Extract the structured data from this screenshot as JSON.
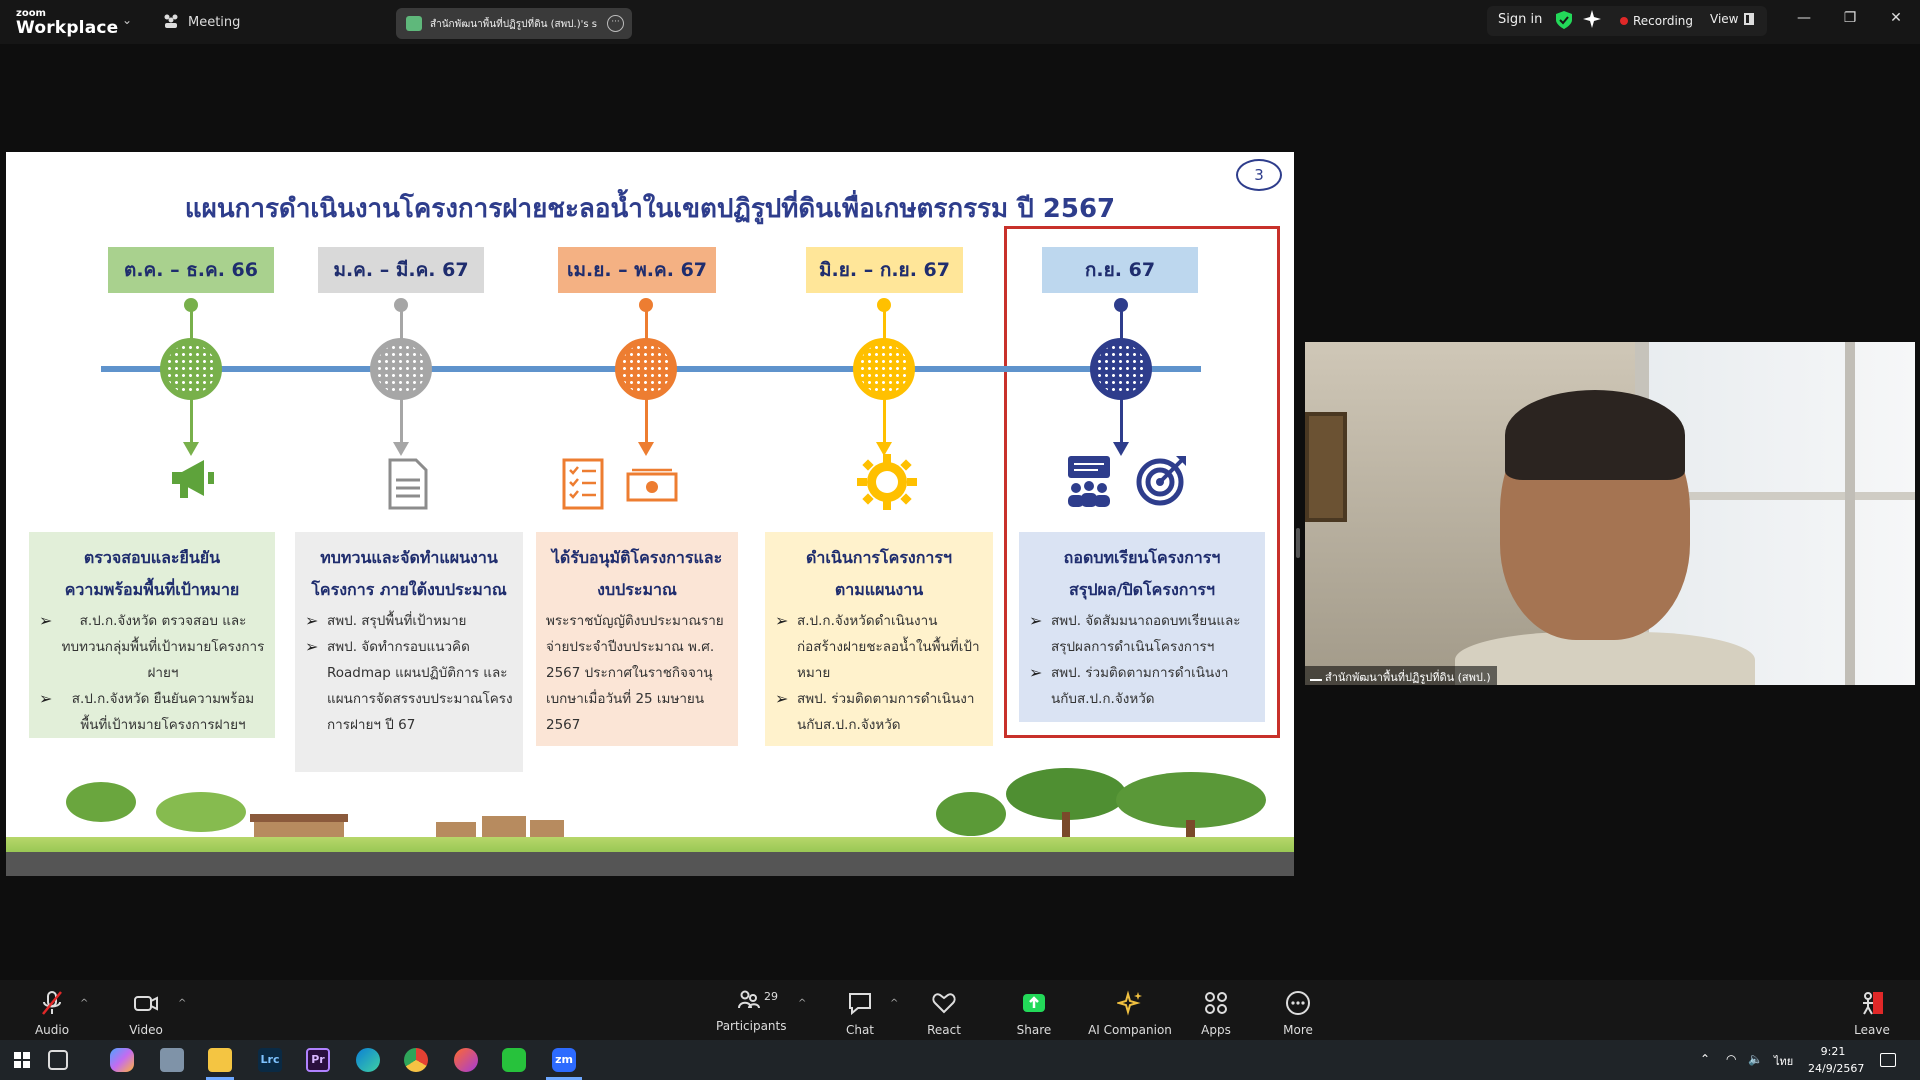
{
  "app": {
    "logo_small": "zoom",
    "logo_big": "Workplace",
    "meeting_label": "Meeting"
  },
  "share_tab": {
    "label": "สำนักพัฒนาพื้นที่ปฏิรูปที่ดิน (สพป.)'s s"
  },
  "top_right": {
    "signin": "Sign in",
    "recording": "Recording",
    "view": "View"
  },
  "slide": {
    "title": "แผนการดำเนินงานโครงการฝายชะลอน้ำในเขตปฏิรูปที่ดินเพื่อเกษตรกรรม ปี 2567",
    "page_number": "3",
    "phases": [
      {
        "label": "ต.ค. – ธ.ค. 66",
        "color": "#78b04b",
        "label_bg": "#a9d18e",
        "heading1": "ตรวจสอบและยืนยัน",
        "heading2": "ความพร้อมพื้นที่เป้าหมาย",
        "bullets": [
          {
            "text": "ส.ป.ก.จังหวัด ตรวจสอบ และทบทวนกลุ่มพื้นที่เป้าหมายโครงการฝายฯ"
          },
          {
            "text": "ส.ป.ก.จังหวัด ยืนยันความพร้อมพื้นที่เป้าหมายโครงการฝายฯ"
          }
        ],
        "card_bg": "#e2efd9",
        "icon": "megaphone-icon"
      },
      {
        "label": "ม.ค. – มี.ค. 67",
        "color": "#a6a6a6",
        "label_bg": "#d9d9d9",
        "heading1": "ทบทวนและจัดทำแผนงาน",
        "heading2": "โครงการ ภายใต้งบประมาณ",
        "bullets": [
          {
            "text": "สพป. สรุปพื้นที่เป้าหมาย"
          },
          {
            "text": "สพป. จัดทำกรอบแนวคิด Roadmap แผนปฏิบัติการ และแผนการจัดสรรงบประมาณโครงการฝายฯ ปี 67"
          }
        ],
        "card_bg": "#ededed",
        "icon": "document-icon"
      },
      {
        "label": "เม.ย. – พ.ค. 67",
        "color": "#ed7d31",
        "label_bg": "#f4b183",
        "heading1": "ได้รับอนุมัติโครงการและ",
        "heading2": "งบประมาณ",
        "body": "พระราชบัญญัติงบประมาณรายจ่ายประจำปีงบประมาณ พ.ศ. 2567 ประกาศในราชกิจจานุเบกษาเมื่อวันที่ 25 เมษายน 2567",
        "card_bg": "#fbe5d6",
        "icon": "checklist-icon"
      },
      {
        "label": "มิ.ย. – ก.ย. 67",
        "color": "#ffc000",
        "label_bg": "#ffe699",
        "heading1": "ดำเนินการโครงการฯ",
        "heading2": "ตามแผนงาน",
        "bullets": [
          {
            "text": "ส.ป.ก.จังหวัดดำเนินงานก่อสร้างฝายชะลอน้ำในพื้นที่เป้าหมาย"
          },
          {
            "text": "สพป. ร่วมติดตามการดำเนินงานกับส.ป.ก.จังหวัด"
          }
        ],
        "card_bg": "#fff2cc",
        "icon": "gear-icon"
      },
      {
        "label": "ก.ย. 67",
        "color": "#2e3d8c",
        "label_bg": "#bdd7ee",
        "heading1": "ถอดบทเรียนโครงการฯ",
        "heading2": "สรุปผล/ปิดโครงการฯ",
        "bullets": [
          {
            "text": "สพป. จัดสัมมนาถอดบทเรียนและสรุปผลการดำเนินโครงการฯ"
          },
          {
            "text": "สพป. ร่วมติดตามการดำเนินงานกับส.ป.ก.จังหวัด"
          }
        ],
        "card_bg": "#dae3f3",
        "icon": "meeting-target-icon"
      }
    ]
  },
  "webcam": {
    "name": "สำนักพัฒนาพื้นที่ปฏิรูปที่ดิน (สพป.)"
  },
  "toolbar": {
    "audio": "Audio",
    "video": "Video",
    "participants": "Participants",
    "participants_count": "29",
    "chat": "Chat",
    "react": "React",
    "share": "Share",
    "ai_companion": "AI Companion",
    "apps": "Apps",
    "more": "More",
    "leave": "Leave"
  },
  "taskbar": {
    "time": "9:21",
    "date": "24/9/2567",
    "lang": "ไทย"
  },
  "colors": {
    "accent_green": "#23d959",
    "record_red": "#e02828",
    "title_navy": "#2e3d8c"
  }
}
